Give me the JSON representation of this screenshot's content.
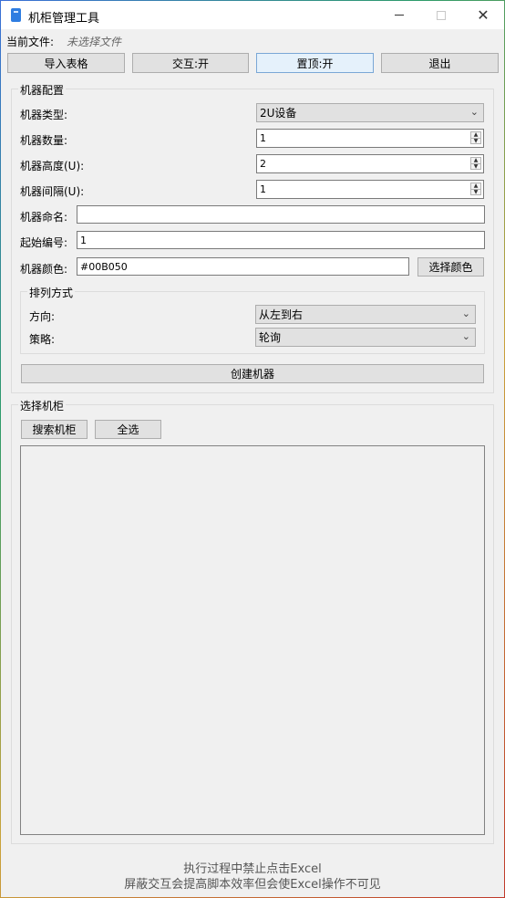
{
  "window": {
    "title": "机柜管理工具",
    "controls": {
      "minimize": "—",
      "maximize": "☐",
      "close": "✕"
    }
  },
  "file": {
    "label": "当前文件:",
    "value": "未选择文件"
  },
  "toolbar": {
    "import_label": "导入表格",
    "interact_label": "交互:开",
    "pin_label": "置顶:开",
    "exit_label": "退出"
  },
  "machine_config": {
    "title": "机器配置",
    "type_label": "机器类型:",
    "type_value": "2U设备",
    "count_label": "机器数量:",
    "count_value": "1",
    "height_label": "机器高度(U):",
    "height_value": "2",
    "gap_label": "机器间隔(U):",
    "gap_value": "1",
    "name_label": "机器命名:",
    "name_value": "",
    "start_label": "起始编号:",
    "start_value": "1",
    "color_label": "机器颜色:",
    "color_value": "#00B050",
    "color_button": "选择颜色",
    "arrangement": {
      "title": "排列方式",
      "direction_label": "方向:",
      "direction_value": "从左到右",
      "strategy_label": "策略:",
      "strategy_value": "轮询"
    },
    "create_button": "创建机器"
  },
  "cabinet": {
    "title": "选择机柜",
    "search_button": "搜索机柜",
    "select_all_button": "全选",
    "items": []
  },
  "footer": {
    "line1": "执行过程中禁止点击Excel",
    "line2": "屏蔽交互会提高脚本效率但会使Excel操作不可见"
  }
}
